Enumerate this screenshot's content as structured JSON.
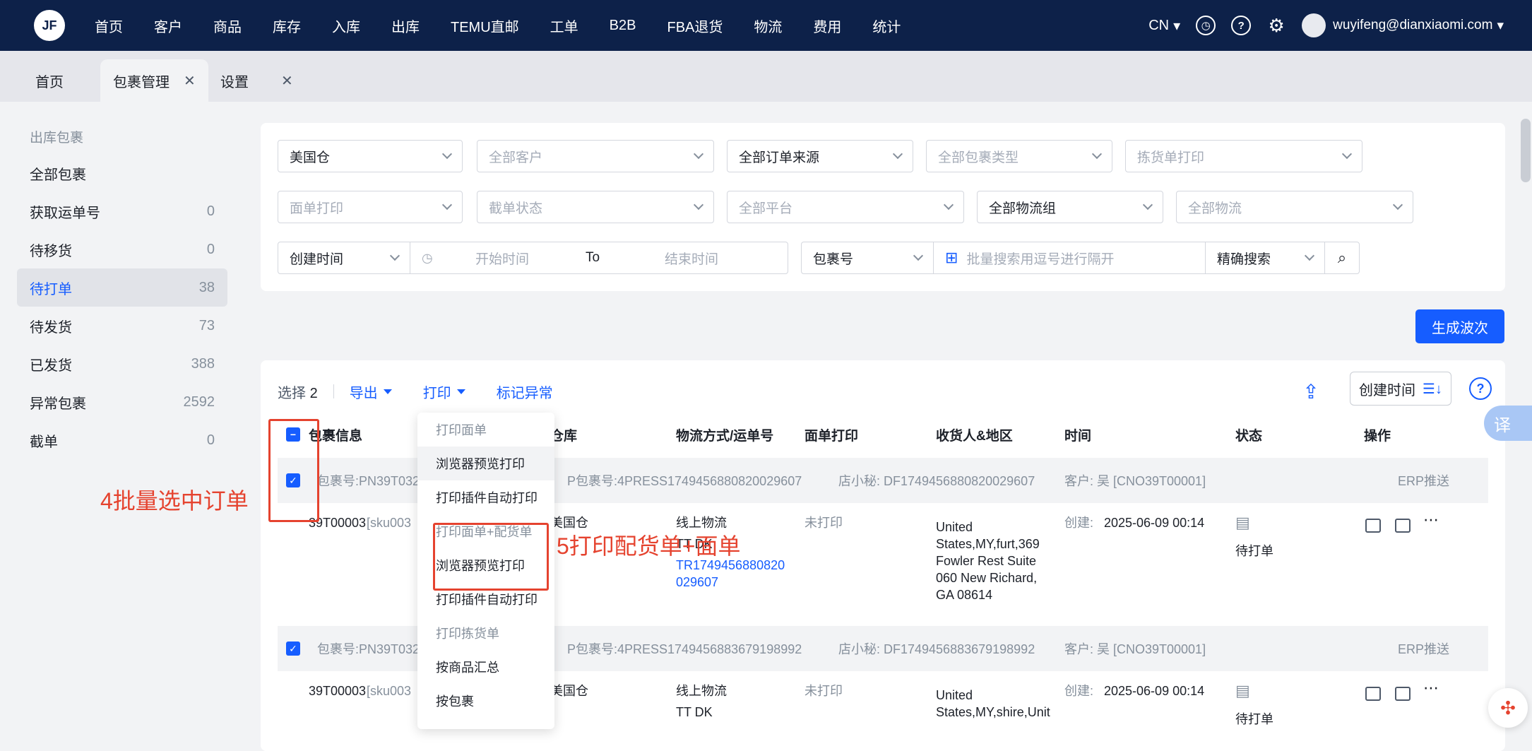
{
  "topnav": {
    "logo": "JF",
    "items": [
      "首页",
      "客户",
      "商品",
      "库存",
      "入库",
      "出库",
      "TEMU直邮",
      "工单",
      "B2B",
      "FBA退货",
      "物流",
      "费用",
      "统计"
    ],
    "active": "出库",
    "lang": "CN",
    "user": "wuyifeng@dianxiaomi.com"
  },
  "tabs": [
    {
      "label": "首页",
      "closable": false
    },
    {
      "label": "包裹管理",
      "closable": true,
      "active": true
    },
    {
      "label": "设置",
      "closable": true
    }
  ],
  "sidebar": {
    "title": "出库包裹",
    "items": [
      {
        "label": "全部包裹",
        "count": ""
      },
      {
        "label": "获取运单号",
        "count": "0"
      },
      {
        "label": "待移货",
        "count": "0"
      },
      {
        "label": "待打单",
        "count": "38",
        "active": true
      },
      {
        "label": "待发货",
        "count": "73"
      },
      {
        "label": "已发货",
        "count": "388"
      },
      {
        "label": "异常包裹",
        "count": "2592"
      },
      {
        "label": "截单",
        "count": "0"
      }
    ]
  },
  "filters": {
    "row1": [
      "美国仓",
      "全部客户",
      "全部订单来源",
      "全部包裹类型",
      "拣货单打印"
    ],
    "row2": [
      "面单打印",
      "截单状态",
      "全部平台",
      "全部物流组",
      "全部物流"
    ],
    "time_type": "创建时间",
    "start_placeholder": "开始时间",
    "to": "To",
    "end_placeholder": "结束时间",
    "search_type": "包裹号",
    "search_placeholder": "批量搜索用逗号进行隔开",
    "search_mode": "精确搜索"
  },
  "generate_button": "生成波次",
  "toolbar": {
    "selected_prefix": "选择",
    "selected_count": "2",
    "export": "导出",
    "print": "打印",
    "mark_abnormal": "标记异常",
    "sort_label": "创建时间"
  },
  "table": {
    "headers": [
      "包裹信息",
      "仓库",
      "物流方式/运单号",
      "面单打印",
      "收货人&地区",
      "时间",
      "状态",
      "操作"
    ],
    "rows": [
      {
        "package_no": "包裹号:PN39T032",
        "partial_wh": "P包裹号:4PRESS1749456880820029607",
        "store": "店小秘:  DF1749456880820029607",
        "customer": "客户: 吴  [CNO39T00001]",
        "erp": "ERP推送",
        "sku_code": "39T00003",
        "sku": "[sku003",
        "warehouse": "美国仓",
        "logistics": "线上物流",
        "carrier": "TT DK",
        "tracking": "TR1749456880820029607",
        "label_print": "未打印",
        "address": "United States,MY,furt,369 Fowler Rest Suite 060 New Richard, GA 08614",
        "created_label": "创建:",
        "created_time": "2025-06-09 00:14",
        "status": "待打单"
      },
      {
        "package_no": "包裹号:PN39T032",
        "partial_wh": "P包裹号:4PRESS1749456883679198992",
        "store": "店小秘:  DF1749456883679198992",
        "customer": "客户: 吴  [CNO39T00001]",
        "erp": "ERP推送",
        "sku_code": "39T00003",
        "sku": "[sku003",
        "warehouse": "美国仓",
        "logistics": "线上物流",
        "carrier": "TT DK",
        "label_print": "未打印",
        "address": "United States,MY,shire,Unit",
        "created_label": "创建:",
        "created_time": "2025-06-09 00:14",
        "status": "待打单"
      }
    ]
  },
  "print_menu": {
    "items": [
      {
        "label": "打印面单",
        "group": true
      },
      {
        "label": "浏览器预览打印"
      },
      {
        "label": "打印插件自动打印"
      },
      {
        "label": "打印面单+配货单",
        "group": true
      },
      {
        "label": "浏览器预览打印"
      },
      {
        "label": "打印插件自动打印"
      },
      {
        "label": "打印拣货单",
        "group": true
      },
      {
        "label": "按商品汇总"
      },
      {
        "label": "按包裹"
      }
    ]
  },
  "annotations": {
    "step4": "4批量选中订单",
    "step5": "5打印配货单+面单"
  },
  "floating": {
    "translate": "译"
  },
  "colors": {
    "nav_bg": "#0d2149",
    "primary": "#165dff",
    "annotation": "#e5432f"
  }
}
